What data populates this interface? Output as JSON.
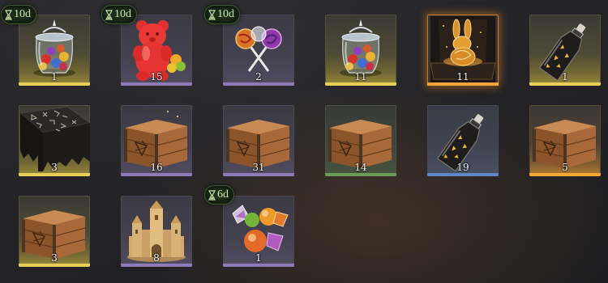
{
  "inventory": {
    "slots": [
      {
        "item": "candy-jar",
        "count": "1",
        "tier": "gold",
        "timer": "10d"
      },
      {
        "item": "gummy-bear",
        "count": "15",
        "tier": "purple",
        "timer": "10d"
      },
      {
        "item": "lollipops",
        "count": "2",
        "tier": "purple",
        "timer": "10d"
      },
      {
        "item": "candy-jar",
        "count": "11",
        "tier": "gold",
        "timer": null
      },
      {
        "item": "golden-rabbit-box",
        "count": "11",
        "tier": "legend",
        "timer": null
      },
      {
        "item": "dark-bottle",
        "count": "1",
        "tier": "gold",
        "timer": null
      },
      {
        "item": "dark-table",
        "count": "3",
        "tier": "gold",
        "timer": null
      },
      {
        "item": "wooden-crate",
        "count": "16",
        "tier": "purple",
        "timer": null
      },
      {
        "item": "wooden-crate",
        "count": "31",
        "tier": "purple",
        "timer": null
      },
      {
        "item": "wooden-crate",
        "count": "14",
        "tier": "green",
        "timer": null
      },
      {
        "item": "dark-bottle",
        "count": "19",
        "tier": "blue",
        "timer": null
      },
      {
        "item": "wooden-crate",
        "count": "5",
        "tier": "orange",
        "timer": null
      },
      {
        "item": "wooden-crate",
        "count": "3",
        "tier": "gold",
        "timer": null
      },
      {
        "item": "sand-castle",
        "count": "8",
        "tier": "purple",
        "timer": null
      },
      {
        "item": "fruit-candies",
        "count": "1",
        "tier": "purple",
        "timer": "6d"
      }
    ]
  },
  "colors": {
    "gold": "#e8cf55",
    "purple": "#8d7bb8",
    "green": "#6a9c57",
    "blue": "#5f87c8",
    "orange": "#f3a635",
    "legend": "#f0a43a",
    "timer_text": "#c9e7a8"
  }
}
